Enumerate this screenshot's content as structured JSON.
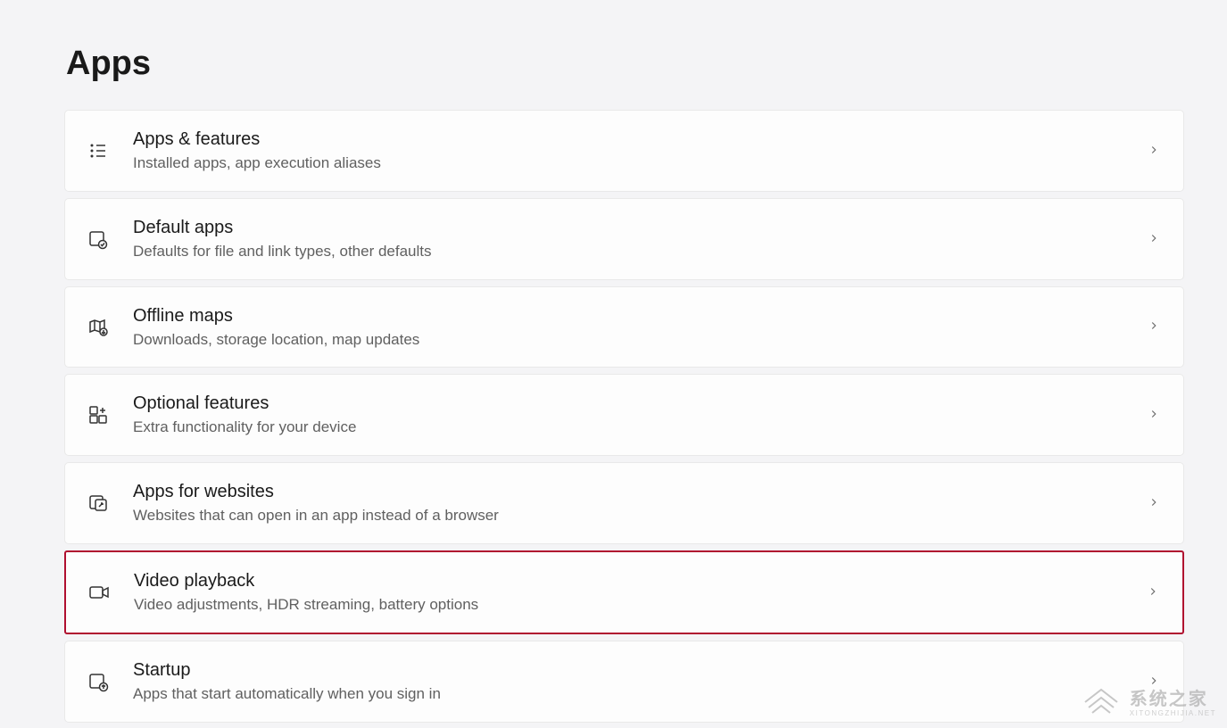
{
  "page": {
    "title": "Apps"
  },
  "items": [
    {
      "title": "Apps & features",
      "subtitle": "Installed apps, app execution aliases"
    },
    {
      "title": "Default apps",
      "subtitle": "Defaults for file and link types, other defaults"
    },
    {
      "title": "Offline maps",
      "subtitle": "Downloads, storage location, map updates"
    },
    {
      "title": "Optional features",
      "subtitle": "Extra functionality for your device"
    },
    {
      "title": "Apps for websites",
      "subtitle": "Websites that can open in an app instead of a browser"
    },
    {
      "title": "Video playback",
      "subtitle": "Video adjustments, HDR streaming, battery options"
    },
    {
      "title": "Startup",
      "subtitle": "Apps that start automatically when you sign in"
    }
  ],
  "watermark": {
    "main": "系统之家",
    "sub": "XITONGZHIJIA.NET"
  }
}
